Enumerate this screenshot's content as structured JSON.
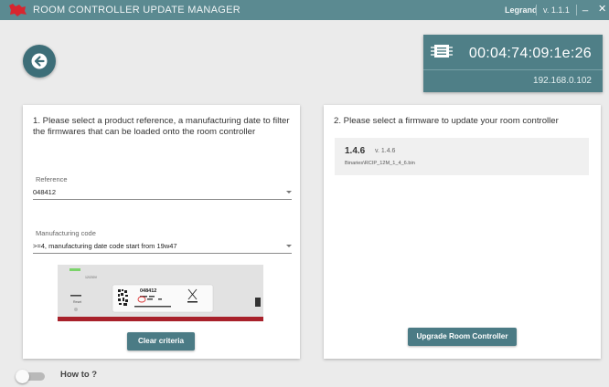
{
  "titlebar": {
    "title": "ROOM CONTROLLER UPDATE MANAGER",
    "vendor": "Legrand",
    "version": "v. 1.1.1",
    "minimize": "_",
    "close": "✕",
    "logo_icon": "legrand-logo",
    "bg_color": "#5b8a91"
  },
  "device": {
    "id": "00:04:74:09:1e:26",
    "ip": "192.168.0.102",
    "icon": "chip-icon"
  },
  "left_card": {
    "title": "1. Please select a product reference, a manufacturing date to filter the firmwares that can be loaded onto the room controller",
    "reference": {
      "label": "Reference",
      "value": "048412"
    },
    "manufacturing": {
      "label": "Manufacturing code",
      "value": ">=4, manufacturing date code start from 19w47"
    },
    "image": {
      "ref_text": "048412",
      "reset_text": "Reset",
      "top_text": "12/230V"
    },
    "clear_button": "Clear criteria"
  },
  "right_card": {
    "title": "2. Please select a firmware to update your room controller",
    "firmware": {
      "name": "1.4.6",
      "version": "v. 1.4.6",
      "path": "Binaries\\RCIP_12M_1_4_6.bin"
    },
    "upgrade_button": "Upgrade Room Controller"
  },
  "footer": {
    "toggle_label": "How to ?"
  },
  "colors": {
    "accent": "#4b7b85",
    "back_button": "#3d6e78",
    "panel": "#4f7f87"
  }
}
